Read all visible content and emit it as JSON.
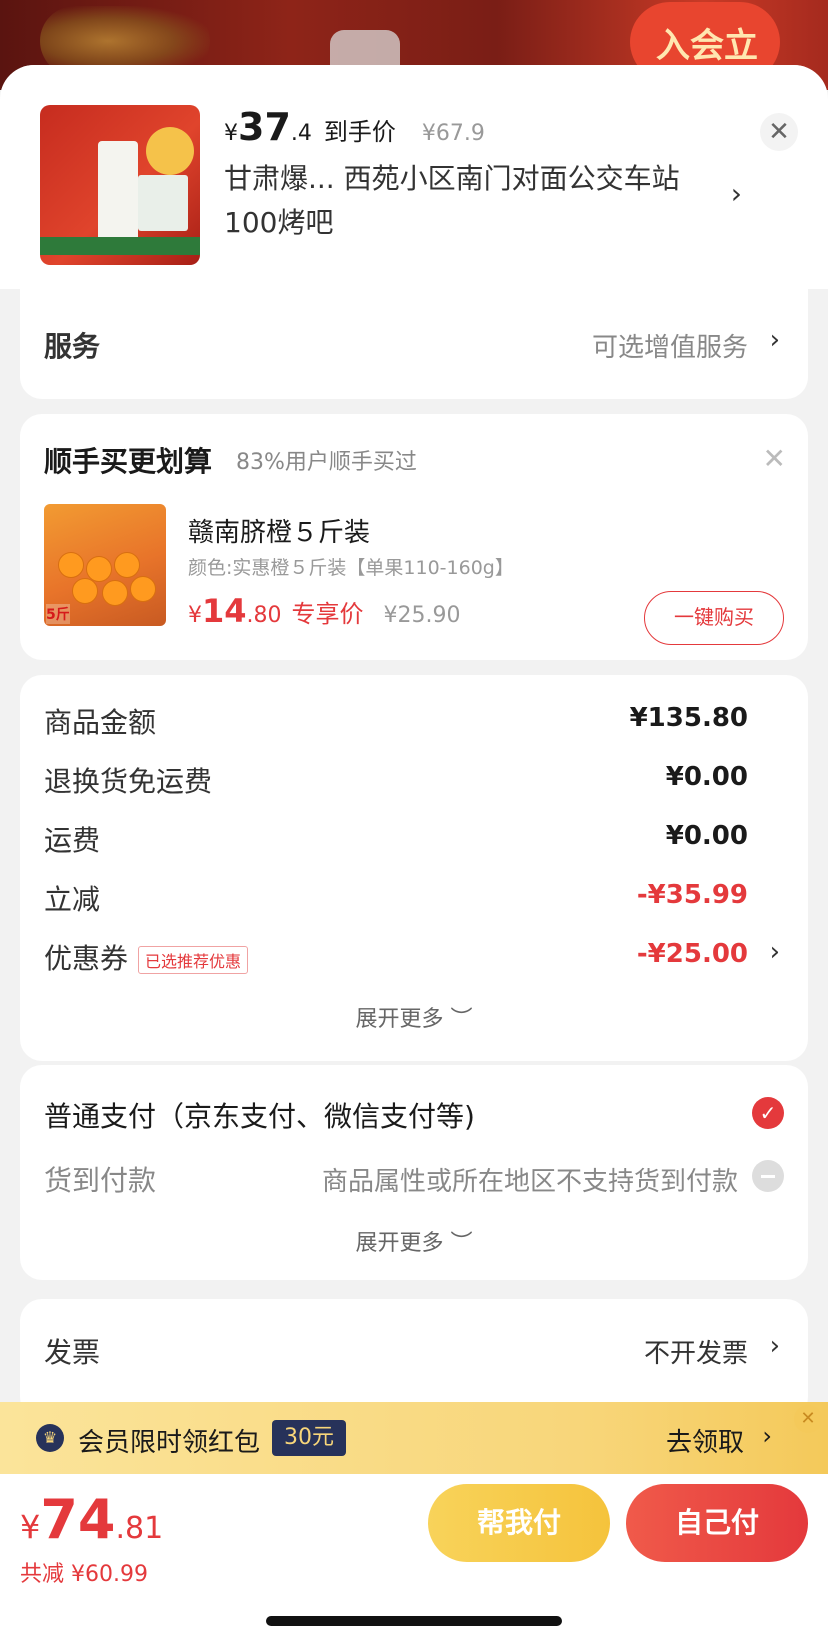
{
  "top_banner": {
    "badge_text": "入会立领"
  },
  "product": {
    "price_yen": "¥",
    "price_int": "37",
    "price_dec": ".4",
    "price_tag": "到手价",
    "original_price": "¥67.9",
    "address": "甘肃爆...  西苑小区南门对面公交车站100烤吧"
  },
  "service": {
    "label": "服务",
    "value": "可选增值服务"
  },
  "bundle": {
    "title": "顺手买更划算",
    "subtitle": "83%用户顺手买过",
    "product_name": "赣南脐橙５斤装",
    "spec": "颜色:实惠橙５斤装【单果110-160g】",
    "price_yen": "¥",
    "price_int": "14",
    "price_dec": ".80",
    "price_tag": "专享价",
    "original_price": "¥25.90",
    "buy_label": "一键购买",
    "img_label": "5斤"
  },
  "amounts": {
    "rows": [
      {
        "label": "商品金额",
        "value": "¥135.80"
      },
      {
        "label": "退换货免运费",
        "value": "¥0.00"
      },
      {
        "label": "运费",
        "value": "¥0.00"
      },
      {
        "label": "立减",
        "value": "-¥35.99"
      },
      {
        "label": "优惠券",
        "value": "-¥25.00",
        "tag": "已选推荐优惠"
      }
    ],
    "expand_label": "展开更多 ︶"
  },
  "payment": {
    "normal_label": "普通支付（京东支付、微信支付等)",
    "cod_label": "货到付款",
    "cod_note": "商品属性或所在地区不支持货到付款",
    "expand_label": "展开更多 ︶"
  },
  "invoice": {
    "label": "发票",
    "value": "不开发票"
  },
  "promo": {
    "text": "会员限时领红包",
    "badge": "30元",
    "action": "去领取"
  },
  "footer": {
    "total_yen": "¥",
    "total_int": "74",
    "total_dec": ".81",
    "saved": "共减 ¥60.99",
    "help_pay": "帮我付",
    "self_pay": "自己付"
  },
  "colors": {
    "accent": "#e4393c",
    "promo_bg": "#f8d67a",
    "badge_navy": "#27325a"
  }
}
